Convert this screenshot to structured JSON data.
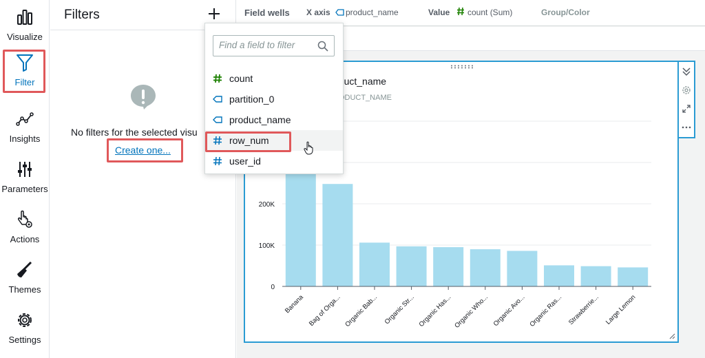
{
  "nav": {
    "items": [
      {
        "label": "Visualize",
        "icon": "bar-chart-icon"
      },
      {
        "label": "Filter",
        "icon": "funnel-icon",
        "active": true
      },
      {
        "label": "Insights",
        "icon": "trend-icon"
      },
      {
        "label": "Parameters",
        "icon": "sliders-icon"
      },
      {
        "label": "Actions",
        "icon": "pointer-gear-icon"
      },
      {
        "label": "Themes",
        "icon": "brush-icon"
      },
      {
        "label": "Settings",
        "icon": "gear-icon"
      }
    ],
    "accent_color": "#0073bb",
    "highlight_color": "#e0585a"
  },
  "filters_panel": {
    "title": "Filters",
    "add_icon": "plus-icon",
    "empty_icon": "exclamation-bubble-icon",
    "empty_message": "No filters for the selected visu",
    "create_link": "Create one..."
  },
  "field_wells": {
    "label": "Field wells",
    "x_axis_label": "X axis",
    "x_axis_field": "product_name",
    "value_label": "Value",
    "value_field": "count (Sum)",
    "group_label": "Group/Color"
  },
  "field_dropdown": {
    "search_placeholder": "Find a field to filter",
    "items": [
      {
        "label": "count",
        "type": "numeric"
      },
      {
        "label": "partition_0",
        "type": "dimension"
      },
      {
        "label": "product_name",
        "type": "dimension"
      },
      {
        "label": "row_num",
        "type": "numeric",
        "hovered": true
      },
      {
        "label": "user_id",
        "type": "numeric"
      }
    ]
  },
  "visual": {
    "title_fragment": "oduct_name",
    "subtitle_fragment": "RODUCT_NAME"
  },
  "chart_data": {
    "type": "bar",
    "categories": [
      "Banana",
      "Bag of Orga...",
      "Organic Bab...",
      "Organic Str...",
      "Organic Has...",
      "Organic Who...",
      "Organic Avo...",
      "Organic Ras...",
      "Strawberrie...",
      "Large Lemon"
    ],
    "values": [
      300000,
      248000,
      106000,
      97000,
      95000,
      90000,
      86000,
      51000,
      49000,
      46000
    ],
    "ylim": [
      0,
      400000
    ],
    "y_ticks": [
      {
        "value": 0,
        "label": "0"
      },
      {
        "value": 100000,
        "label": "100K"
      },
      {
        "value": 200000,
        "label": "200K"
      }
    ],
    "bar_color": "#a6dcef",
    "grid": true
  }
}
